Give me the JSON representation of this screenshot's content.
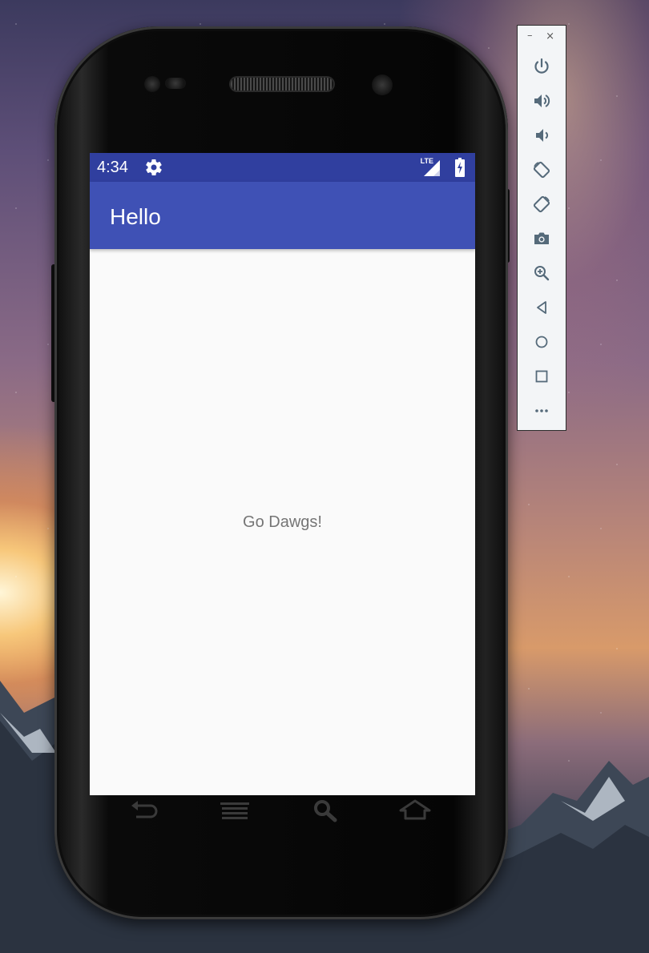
{
  "status_bar": {
    "time": "4:34",
    "network": "LTE",
    "settings_icon": "gear-icon",
    "battery_icon": "battery-charging-icon"
  },
  "app_bar": {
    "title": "Hello"
  },
  "content": {
    "message": "Go Dawgs!"
  },
  "nav_keys": [
    "back-icon",
    "menu-icon",
    "search-icon",
    "home-icon"
  ],
  "toolbar": {
    "minimize": "–",
    "close": "×",
    "buttons": [
      "power-icon",
      "volume-up-icon",
      "volume-down-icon",
      "rotate-left-icon",
      "rotate-right-icon",
      "camera-icon",
      "zoom-icon",
      "back-icon",
      "home-icon",
      "overview-icon",
      "more-icon"
    ]
  },
  "colors": {
    "status_bar": "#303f9f",
    "app_bar": "#3f51b5",
    "content_bg": "#fafafa",
    "message_text": "#757575"
  }
}
